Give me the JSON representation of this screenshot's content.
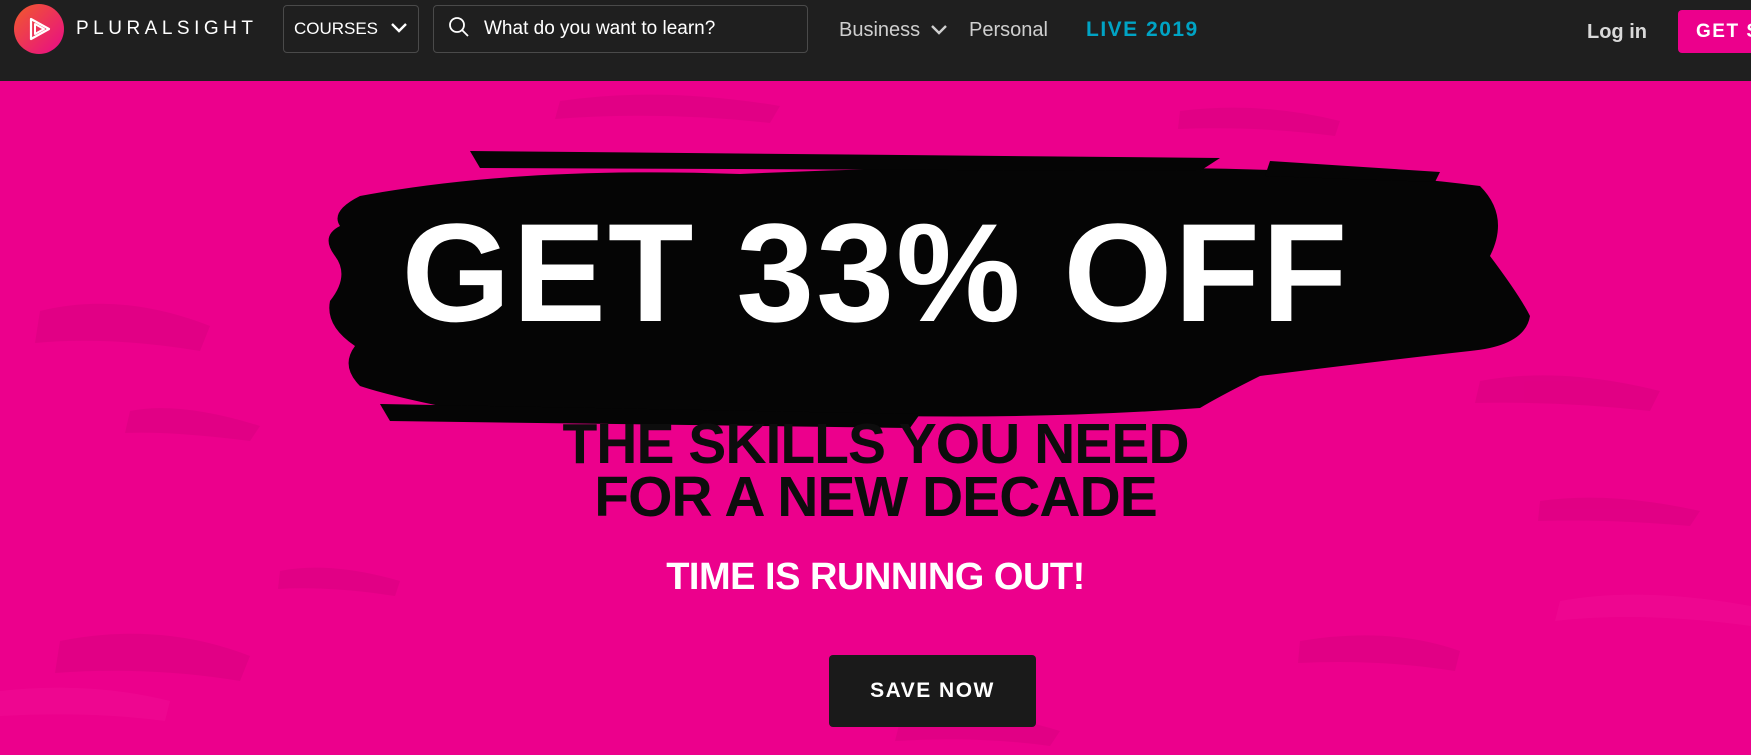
{
  "nav": {
    "logo_text": "PLURALSIGHT",
    "courses_label": "COURSES",
    "search_placeholder": "What do you want to learn?",
    "business_label": "Business",
    "personal_label": "Personal",
    "live_label": "LIVE 2019",
    "login_label": "Log in",
    "get_started_label": "GET S"
  },
  "hero": {
    "headline": "GET 33% OFF",
    "subhead_line1": "THE SKILLS YOU NEED",
    "subhead_line2": "FOR A NEW DECADE",
    "urgency": "TIME IS RUNNING OUT!",
    "cta_label": "SAVE NOW"
  },
  "colors": {
    "nav_bg": "#1f1f1f",
    "brand_pink": "#ec008c",
    "live_blue": "#00a3c4",
    "button_dark": "#1a1a1a"
  },
  "icons": {
    "logo": "play-triangle-icon",
    "courses_dropdown": "chevron-down-icon",
    "search": "search-icon",
    "business_dropdown": "chevron-down-icon"
  }
}
